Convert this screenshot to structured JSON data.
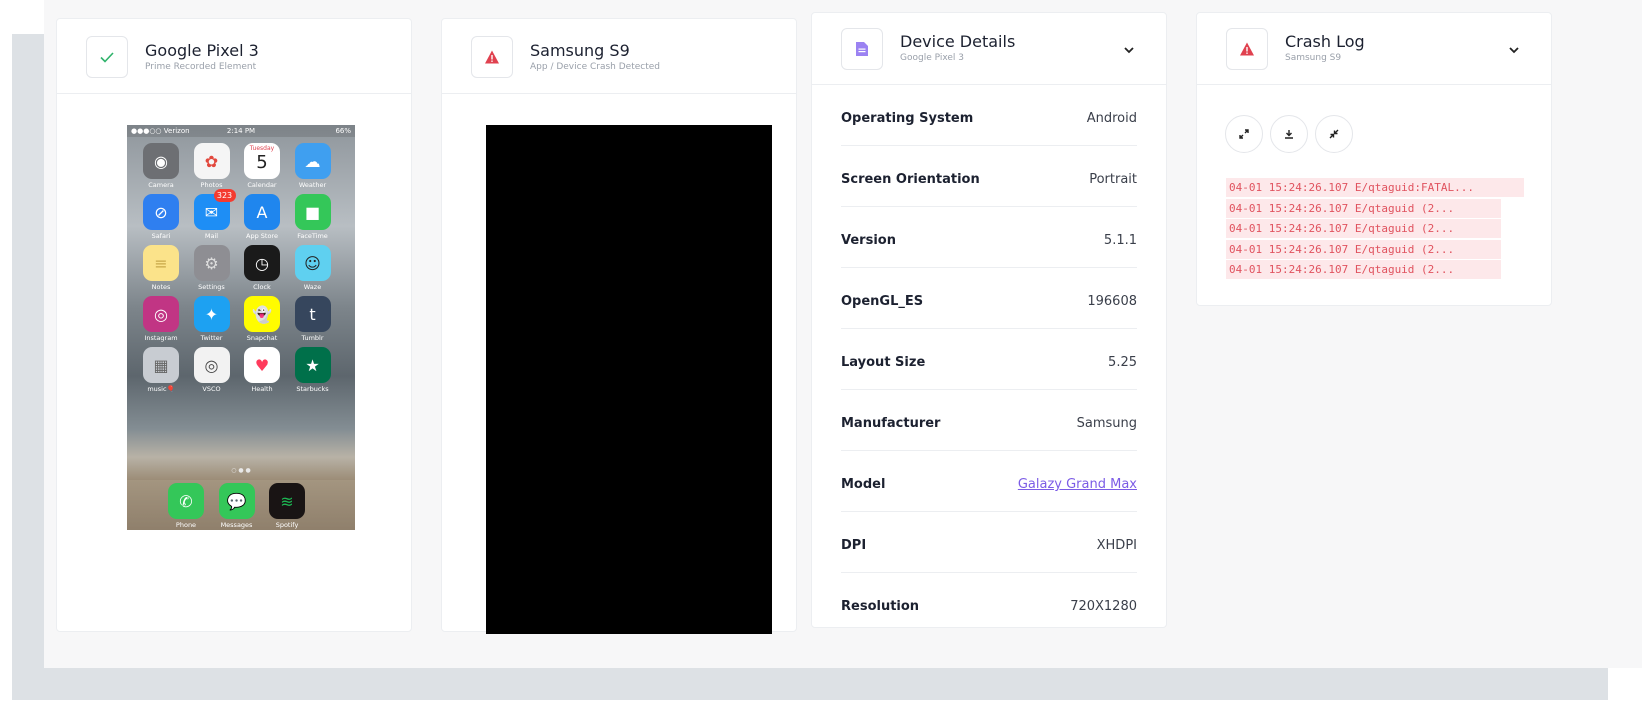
{
  "colors": {
    "success": "#2fb36b",
    "danger": "#e0414f",
    "accent": "#8a6cf0",
    "link": "#7c5ce6",
    "log_bg": "#fde8ea",
    "log_text": "#e0535f"
  },
  "card_pixel": {
    "title": "Google Pixel 3",
    "subtitle": "Prime Recorded Element",
    "icon": "check-icon",
    "phone": {
      "status_left": "●●●○○ Verizon",
      "status_center": "2:14 PM",
      "status_right": "66%",
      "calendar_day": "Tuesday",
      "calendar_date": "5",
      "mail_badge": "323",
      "apps": [
        "Camera",
        "Photos",
        "Calendar",
        "Weather",
        "Safari",
        "Mail",
        "App Store",
        "FaceTime",
        "Notes",
        "Settings",
        "Clock",
        "Waze",
        "Instagram",
        "Twitter",
        "Snapchat",
        "Tumblr",
        "music🎈",
        "VSCO",
        "Health",
        "Starbucks"
      ],
      "dock": [
        "Phone",
        "Messages",
        "Spotify"
      ]
    }
  },
  "card_samsung": {
    "title": "Samsung S9",
    "subtitle": "App / Device Crash Detected",
    "icon": "warning-icon"
  },
  "card_details": {
    "title": "Device Details",
    "subtitle": "Google Pixel 3",
    "icon": "document-icon",
    "rows": [
      {
        "label": "Operating System",
        "value": "Android"
      },
      {
        "label": "Screen Orientation",
        "value": "Portrait"
      },
      {
        "label": "Version",
        "value": "5.1.1"
      },
      {
        "label": "OpenGL_ES",
        "value": "196608"
      },
      {
        "label": "Layout Size",
        "value": "5.25"
      },
      {
        "label": "Manufacturer",
        "value": "Samsung"
      },
      {
        "label": "Model",
        "value": "Galazy Grand Max"
      },
      {
        "label": "DPI",
        "value": "XHDPI"
      },
      {
        "label": "Resolution",
        "value": "720X1280"
      }
    ]
  },
  "card_crash": {
    "title": "Crash Log",
    "subtitle": "Samsung S9",
    "icon": "warning-icon",
    "actions": [
      "expand-icon",
      "download-icon",
      "collapse-icon"
    ],
    "log_lines": [
      "04-01 15:24:26.107 E/qtaguid:FATAL...",
      "04-01 15:24:26.107 E/qtaguid (2...",
      "04-01 15:24:26.107 E/qtaguid (2...",
      "04-01 15:24:26.107 E/qtaguid (2...",
      "04-01 15:24:26.107 E/qtaguid (2..."
    ]
  }
}
